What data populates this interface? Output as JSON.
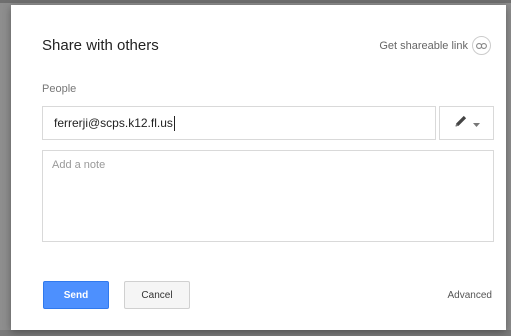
{
  "dialog": {
    "title": "Share with others",
    "get_link_label": "Get shareable link",
    "people_label": "People",
    "email_value": "ferrerji@scps.k12.fl.us",
    "note_placeholder": "Add a note",
    "send_label": "Send",
    "cancel_label": "Cancel",
    "advanced_label": "Advanced"
  },
  "icons": {
    "link": "link-icon",
    "pencil": "pencil-icon",
    "dropdown": "chevron-down-icon"
  },
  "colors": {
    "send_button": "#4d90fe",
    "send_border": "#3079ed",
    "dialog_bg": "#ffffff",
    "backdrop": "#8e8e8e"
  }
}
